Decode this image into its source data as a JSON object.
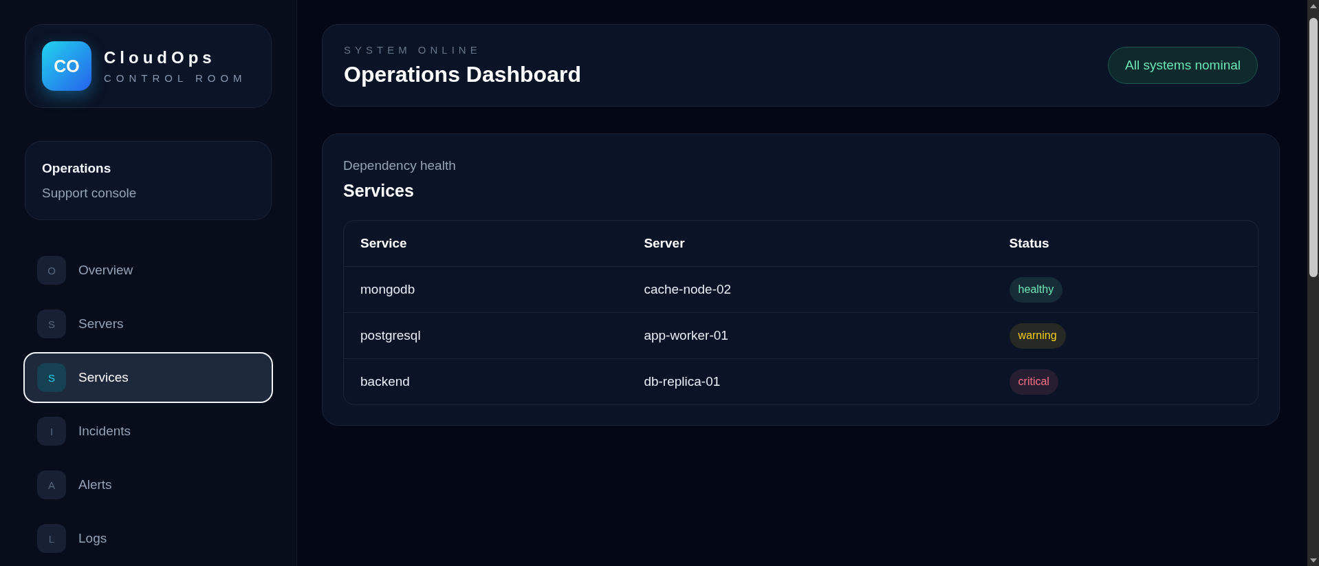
{
  "sidebar": {
    "brand": {
      "logo": "CO",
      "name": "CloudOps",
      "tagline": "CONTROL ROOM"
    },
    "workspace": {
      "title": "Operations",
      "subtitle": "Support console"
    },
    "nav": [
      {
        "initial": "O",
        "label": "Overview",
        "selected": false
      },
      {
        "initial": "S",
        "label": "Servers",
        "selected": false
      },
      {
        "initial": "S",
        "label": "Services",
        "selected": true
      },
      {
        "initial": "I",
        "label": "Incidents",
        "selected": false
      },
      {
        "initial": "A",
        "label": "Alerts",
        "selected": false
      },
      {
        "initial": "L",
        "label": "Logs",
        "selected": false
      }
    ]
  },
  "header": {
    "eyebrow": "SYSTEM ONLINE",
    "title": "Operations Dashboard",
    "status_pill": "All systems nominal"
  },
  "services_panel": {
    "subtitle": "Dependency health",
    "title": "Services",
    "table": {
      "columns": [
        "Service",
        "Server",
        "Status"
      ],
      "rows": [
        {
          "service": "mongodb",
          "server": "cache-node-02",
          "status": {
            "label": "healthy",
            "color": "#6ee7b7"
          }
        },
        {
          "service": "postgresql",
          "server": "app-worker-01",
          "status": {
            "label": "warning",
            "color": "#facc15"
          }
        },
        {
          "service": "backend",
          "server": "db-replica-01",
          "status": {
            "label": "critical",
            "color": "#fb7185"
          }
        }
      ]
    }
  }
}
